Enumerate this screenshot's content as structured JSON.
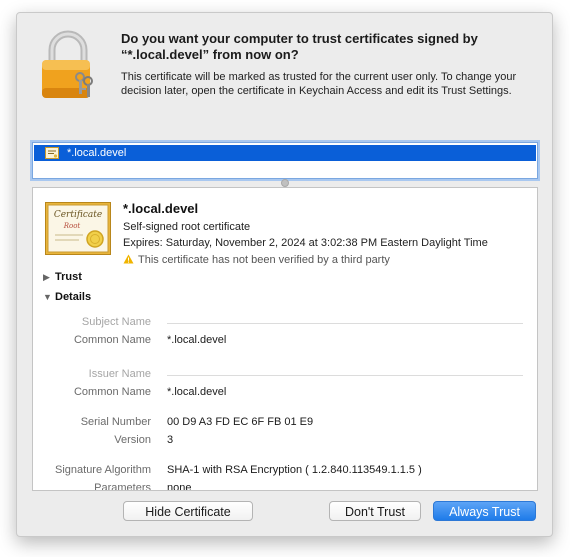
{
  "dialog": {
    "heading": "Do you want your computer to trust certificates signed by “*.local.devel” from now on?",
    "message": "This certificate will be marked as trusted for the current user only. To change your decision later, open the certificate in Keychain Access and edit its Trust Settings."
  },
  "cert_list": {
    "selected_item": "*.local.devel"
  },
  "certificate": {
    "name": "*.local.devel",
    "type": "Self-signed root certificate",
    "expires": "Expires: Saturday, November 2, 2024 at 3:02:38 PM Eastern Daylight Time",
    "warning": "This certificate has not been verified by a third party",
    "image_caption": "Certificate",
    "image_subcaption": "Root"
  },
  "sections": {
    "trust_label": "Trust",
    "details_label": "Details"
  },
  "details": {
    "subject_name_label": "Subject Name",
    "subject_common_name_label": "Common Name",
    "subject_common_name_value": "*.local.devel",
    "issuer_name_label": "Issuer Name",
    "issuer_common_name_label": "Common Name",
    "issuer_common_name_value": "*.local.devel",
    "serial_number_label": "Serial Number",
    "serial_number_value": "00 D9 A3 FD EC 6F FB 01 E9",
    "version_label": "Version",
    "version_value": "3",
    "signature_algorithm_label": "Signature Algorithm",
    "signature_algorithm_value": "SHA-1 with RSA Encryption ( 1.2.840.113549.1.1.5 )",
    "parameters_label": "Parameters",
    "parameters_value": "none"
  },
  "buttons": {
    "hide_certificate": "Hide Certificate",
    "dont_trust": "Don't Trust",
    "always_trust": "Always Trust"
  },
  "icons": {
    "dialog_icon": "padlock-with-keys-icon",
    "row_icon": "certificate-small-icon",
    "cert_image": "certificate-large-icon",
    "warning_icon": "warning-triangle-icon"
  },
  "colors": {
    "accent": "#0a5fd8",
    "primary_button": "#1e7be9",
    "warning": "#f0b400"
  }
}
